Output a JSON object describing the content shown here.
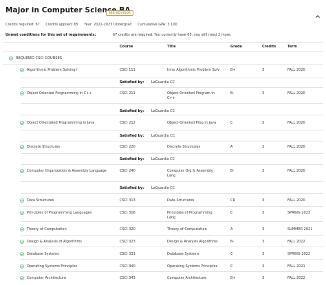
{
  "header": {
    "title": "Major in Computer Science BA",
    "badge": "SEE ADVISOR",
    "credits_required": "Credits required:  67",
    "credits_applied": "Credits applied:  65",
    "year": "Year:  2022-2023 Undergrad",
    "gpa": "Cumulative GPA:  3.100"
  },
  "unmet": {
    "label": "Unmet conditions for this set of requirements:",
    "text": "67 credits are required. You currently have 65, you still need 2 more."
  },
  "columns": {
    "course": "Course",
    "title": "Title",
    "grade": "Grade",
    "credits": "Credits",
    "term": "Term"
  },
  "group": {
    "label": "REQUIRED CSCI COURSES"
  },
  "satisfied_label": "Satisfied by:",
  "rows": [
    {
      "name": "Algorithmic Problem Solving I",
      "course": "CSCI 111",
      "title": "Intro Algorithmic Problem Solv",
      "grade": "B+",
      "credits": "3",
      "term": "FALL 2020",
      "satisfied": "LaGuardia CC"
    },
    {
      "name": "Object Oriented Programming in C++",
      "course": "CSCI 211",
      "title": "Object-Oriented Program in C++",
      "grade": "B-",
      "credits": "3",
      "term": "FALL 2020",
      "satisfied": "LaGuardia CC"
    },
    {
      "name": "Object Orientated Programming in Java",
      "course": "CSCI 212",
      "title": "Object-Oriented Prog in Java",
      "grade": "C",
      "credits": "3",
      "term": "FALL 2020",
      "satisfied": "LaGuardia CC"
    },
    {
      "name": "Discrete Structures",
      "course": "CSCI 220",
      "title": "Discrete Structures",
      "grade": "A",
      "credits": "3",
      "term": "FALL 2020",
      "satisfied": "LaGuardia CC"
    },
    {
      "name": "Computer Organization & Assembly Language",
      "course": "CSCI 240",
      "title": "Computer Org & Assembly Lang",
      "grade": "B-",
      "credits": "3",
      "term": "FALL 2020",
      "satisfied": "LaGuardia CC"
    },
    {
      "name": "Data Structures",
      "course": "CSCI 313",
      "title": "Data Structures",
      "grade": "CR",
      "credits": "3",
      "term": "FALL 2020"
    },
    {
      "name": "Principles of Programming Languages",
      "course": "CSCI 316",
      "title": "Principles of Programming Lang",
      "grade": "C",
      "credits": "3",
      "term": "SPRING 2023"
    },
    {
      "name": "Theory of Computation",
      "course": "CSCI 320",
      "title": "Theory of Computation",
      "grade": "A",
      "credits": "3",
      "term": "SUMMER 2021"
    },
    {
      "name": "Design & Analysis of Algorithms",
      "course": "CSCI 323",
      "title": "Design & Analysis Algorithms",
      "grade": "B-",
      "credits": "3",
      "term": "FALL 2022"
    },
    {
      "name": "Database Systems",
      "course": "CSCI 331",
      "title": "Database Systems",
      "grade": "C",
      "credits": "3",
      "term": "SPRING 2022"
    },
    {
      "name": "Operating Systems Principles",
      "course": "CSCI 340",
      "title": "Operating Systems Principles",
      "grade": "C",
      "credits": "3",
      "term": "FALL 2021"
    },
    {
      "name": "Computer Architecture",
      "course": "CSCI 343",
      "title": "Computer Architecture",
      "grade": "B+",
      "credits": "3",
      "term": "FALL 2022"
    }
  ],
  "colors": {
    "check": "#2e9e4f",
    "badge_border": "#b8a25a",
    "rule": "#e2e2e2"
  }
}
